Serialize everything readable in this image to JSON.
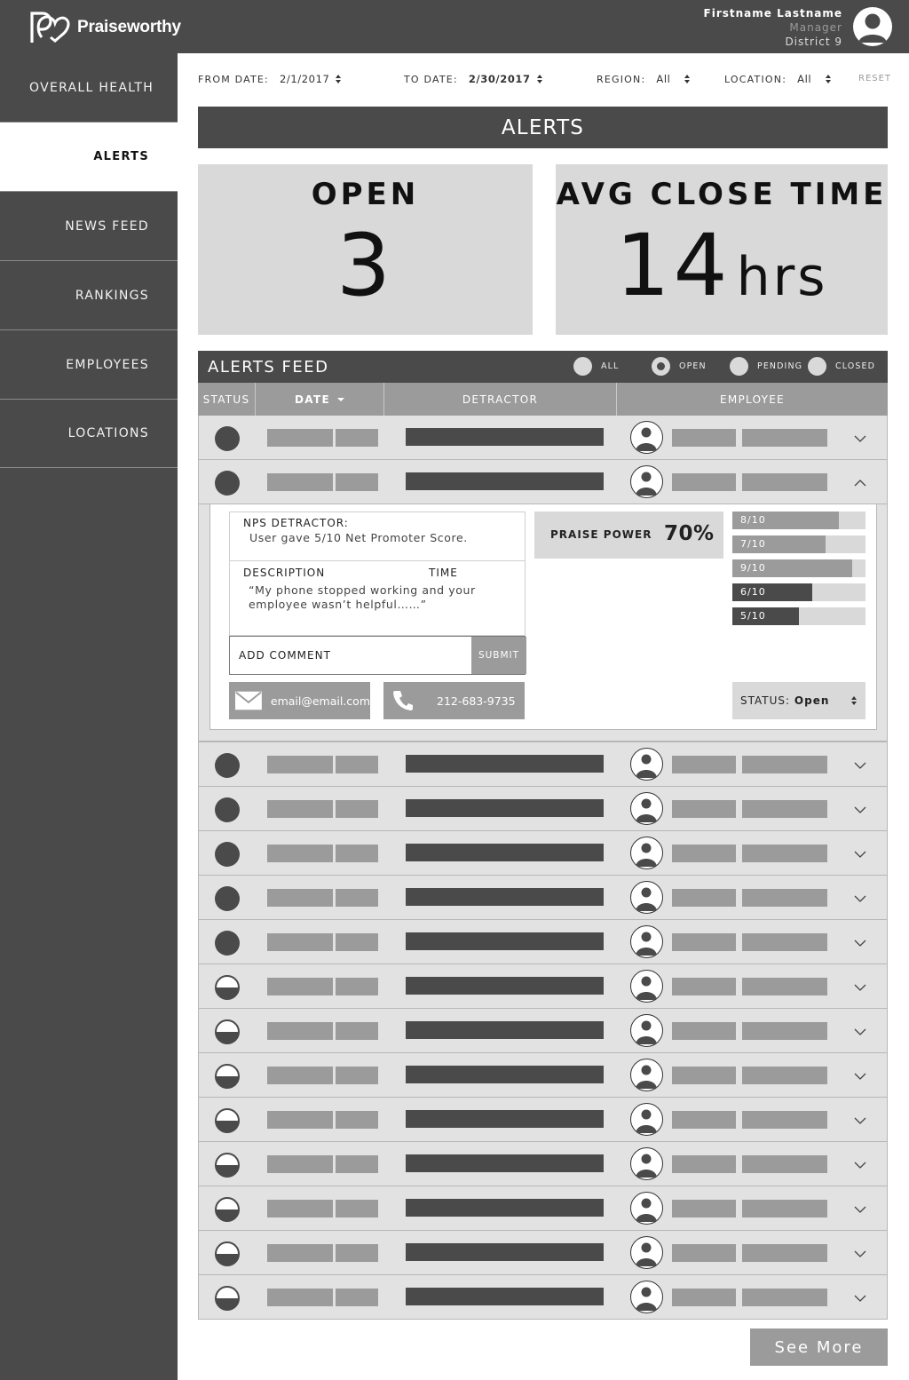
{
  "brand": {
    "name": "Praiseworthy"
  },
  "user": {
    "name": "Firstname Lastname",
    "role": "Manager",
    "district": "District 9"
  },
  "nav": [
    {
      "label": "OVERALL HEALTH"
    },
    {
      "label": "ALERTS"
    },
    {
      "label": "NEWS FEED"
    },
    {
      "label": "RANKINGS"
    },
    {
      "label": "EMPLOYEES"
    },
    {
      "label": "LOCATIONS"
    }
  ],
  "filters": {
    "from_label": "FROM DATE:",
    "from_value": "2/1/2017",
    "to_label": "TO DATE:",
    "to_value": "2/30/2017",
    "region_label": "REGION:",
    "region_value": "All",
    "location_label": "LOCATION:",
    "location_value": "All",
    "reset": "RESET"
  },
  "page_title": "ALERTS",
  "stats": {
    "open_label": "OPEN",
    "open_value": "3",
    "avg_label": "AVG CLOSE TIME",
    "avg_value": "14",
    "avg_unit": "hrs"
  },
  "feed": {
    "title": "ALERTS FEED",
    "filters": [
      {
        "label": "ALL",
        "selected": false
      },
      {
        "label": "OPEN",
        "selected": true
      },
      {
        "label": "PENDING",
        "selected": false
      },
      {
        "label": "CLOSED",
        "selected": false
      }
    ],
    "columns": {
      "status": "STATUS",
      "date": "DATE",
      "detractor": "DETRACTOR",
      "employee": "EMPLOYEE"
    }
  },
  "rows_before": [
    {
      "status": "open",
      "expanded": false
    },
    {
      "status": "open",
      "expanded": true
    }
  ],
  "rows_after": [
    {
      "status": "open"
    },
    {
      "status": "open"
    },
    {
      "status": "open"
    },
    {
      "status": "open"
    },
    {
      "status": "open"
    },
    {
      "status": "pending"
    },
    {
      "status": "pending"
    },
    {
      "status": "pending"
    },
    {
      "status": "pending"
    },
    {
      "status": "pending"
    },
    {
      "status": "pending"
    },
    {
      "status": "pending"
    },
    {
      "status": "pending"
    }
  ],
  "detail": {
    "nps_label": "NPS DETRACTOR:",
    "nps_value": "User gave 5/10 Net Promoter Score.",
    "desc_label": "DESCRIPTION",
    "time_label": "TIME",
    "desc_value": "“My phone stopped working and your employee wasn’t helpful……”",
    "comment_placeholder": "ADD COMMENT",
    "submit": "SUBMIT",
    "email": "email@email.com",
    "phone": "212-683-9735",
    "praise_label": "PRAISE POWER",
    "praise_value": "70%",
    "score_bars": [
      {
        "label": "8/10",
        "fraction": 0.8,
        "color": "#9b9b9b"
      },
      {
        "label": "7/10",
        "fraction": 0.7,
        "color": "#9b9b9b"
      },
      {
        "label": "9/10",
        "fraction": 0.9,
        "color": "#9b9b9b"
      },
      {
        "label": "6/10",
        "fraction": 0.6,
        "color": "#4a4a4a"
      },
      {
        "label": "5/10",
        "fraction": 0.5,
        "color": "#4a4a4a"
      }
    ],
    "status_label": "STATUS:",
    "status_value": "Open"
  },
  "see_more": "See More"
}
